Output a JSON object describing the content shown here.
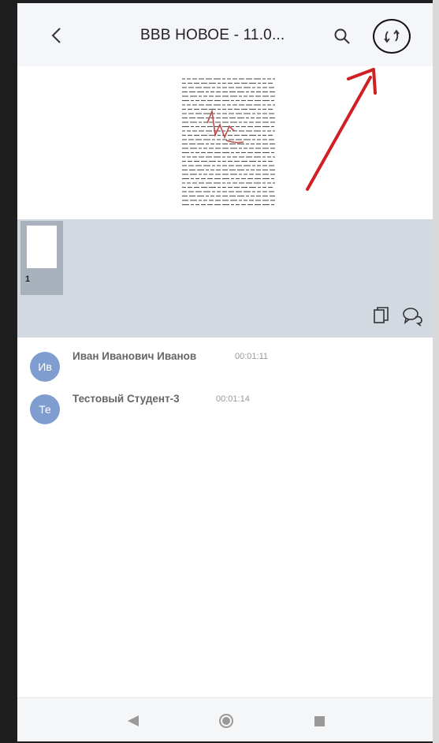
{
  "header": {
    "title": "BBB НОВОЕ - 11.0...",
    "back_icon": "chevron-left-icon",
    "search_icon": "search-icon",
    "sync_icon": "sync-icon"
  },
  "thumbnails": [
    {
      "page_number": "1"
    }
  ],
  "toolbar": {
    "copy_icon": "copy-icon",
    "chat_icon": "chat-icon"
  },
  "participants": [
    {
      "initials": "Ив",
      "name": "Иван Иванович Иванов",
      "time": "00:01:11"
    },
    {
      "initials": "Те",
      "name": "Тестовый Студент-3",
      "time": "00:01:14"
    }
  ],
  "colors": {
    "header_bg": "#f4f6f9",
    "thumb_strip_bg": "#d3d9e0",
    "avatar": "#7f9ecf",
    "annotation_red": "#d11f24"
  }
}
